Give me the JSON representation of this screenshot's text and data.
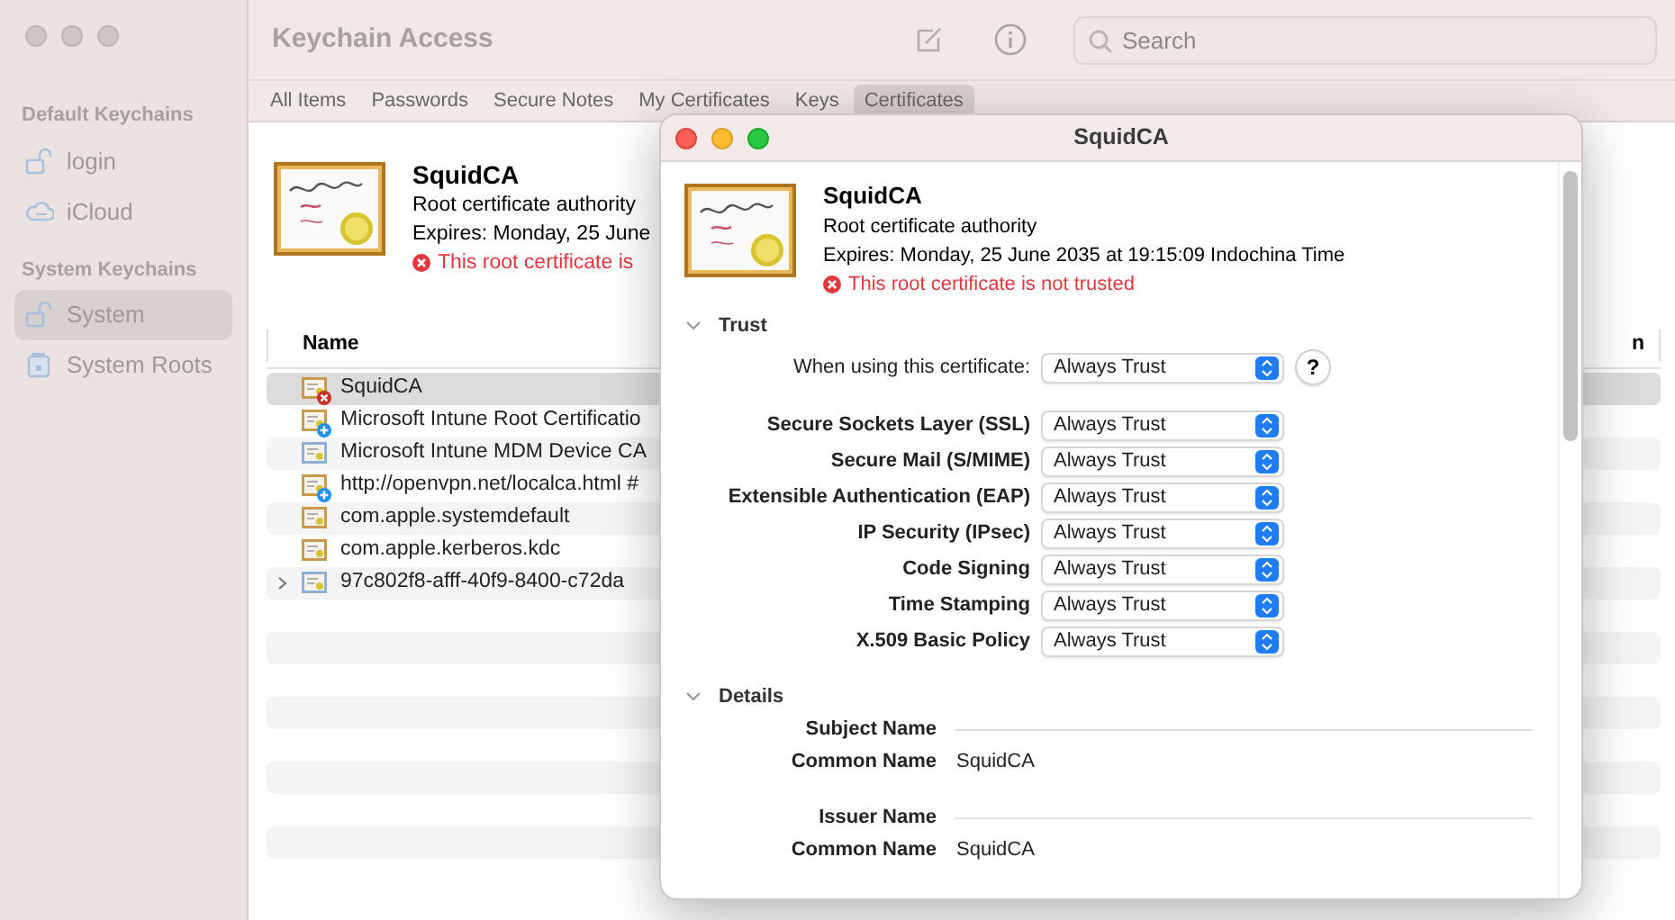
{
  "window": {
    "title": "Keychain Access",
    "search": {
      "placeholder": "Search"
    }
  },
  "sidebar": {
    "sections": [
      {
        "title": "Default Keychains",
        "items": [
          {
            "label": "login",
            "kind": "lock",
            "selected": false
          },
          {
            "label": "iCloud",
            "kind": "cloud",
            "selected": false
          }
        ]
      },
      {
        "title": "System Keychains",
        "items": [
          {
            "label": "System",
            "kind": "lock",
            "selected": true
          },
          {
            "label": "System Roots",
            "kind": "safe",
            "selected": false
          }
        ]
      }
    ]
  },
  "tabs": [
    {
      "label": "All Items",
      "selected": false
    },
    {
      "label": "Passwords",
      "selected": false
    },
    {
      "label": "Secure Notes",
      "selected": false
    },
    {
      "label": "My Certificates",
      "selected": false
    },
    {
      "label": "Keys",
      "selected": false
    },
    {
      "label": "Certificates",
      "selected": true
    }
  ],
  "summary": {
    "name": "SquidCA",
    "subtitle": "Root certificate authority",
    "expires": "Expires: Monday, 25 June",
    "warning": "This root certificate is"
  },
  "table": {
    "columns": [
      "Name",
      "n"
    ],
    "rows": [
      {
        "name": "SquidCA",
        "color": "#c99a4e",
        "kind": "untrusted",
        "expandable": false,
        "selected": true
      },
      {
        "name": "Microsoft Intune Root Certificatio",
        "color": "#c99a4e",
        "kind": "added",
        "expandable": false,
        "selected": false
      },
      {
        "name": "Microsoft Intune MDM Device CA",
        "color": "#8fb0d6",
        "kind": "plain",
        "expandable": false,
        "selected": false
      },
      {
        "name": "http://openvpn.net/localca.html #",
        "color": "#c99a4e",
        "kind": "added",
        "expandable": false,
        "selected": false
      },
      {
        "name": "com.apple.systemdefault",
        "color": "#c99a4e",
        "kind": "plain",
        "expandable": false,
        "selected": false
      },
      {
        "name": "com.apple.kerberos.kdc",
        "color": "#c99a4e",
        "kind": "plain",
        "expandable": false,
        "selected": false
      },
      {
        "name": "97c802f8-afff-40f9-8400-c72da",
        "color": "#8fb0d6",
        "kind": "plain",
        "expandable": true,
        "selected": false
      }
    ]
  },
  "dialog": {
    "title": "SquidCA",
    "name": "SquidCA",
    "subtitle": "Root certificate authority",
    "expires": "Expires: Monday, 25 June 2035 at 19:15:09 Indochina Time",
    "warning": "This root certificate is not trusted",
    "trust": {
      "title": "Trust",
      "expanded": true,
      "when_label": "When using this certificate:",
      "when_value": "Always Trust",
      "help": "?",
      "policies": [
        {
          "label": "Secure Sockets Layer (SSL)",
          "value": "Always Trust"
        },
        {
          "label": "Secure Mail (S/MIME)",
          "value": "Always Trust"
        },
        {
          "label": "Extensible Authentication (EAP)",
          "value": "Always Trust"
        },
        {
          "label": "IP Security (IPsec)",
          "value": "Always Trust"
        },
        {
          "label": "Code Signing",
          "value": "Always Trust"
        },
        {
          "label": "Time Stamping",
          "value": "Always Trust"
        },
        {
          "label": "X.509 Basic Policy",
          "value": "Always Trust"
        }
      ]
    },
    "details": {
      "title": "Details",
      "expanded": true,
      "groups": [
        {
          "heading": "Subject Name",
          "fields": [
            {
              "label": "Common Name",
              "value": "SquidCA"
            }
          ]
        },
        {
          "heading": "Issuer Name",
          "fields": [
            {
              "label": "Common Name",
              "value": "SquidCA"
            }
          ]
        }
      ]
    }
  }
}
